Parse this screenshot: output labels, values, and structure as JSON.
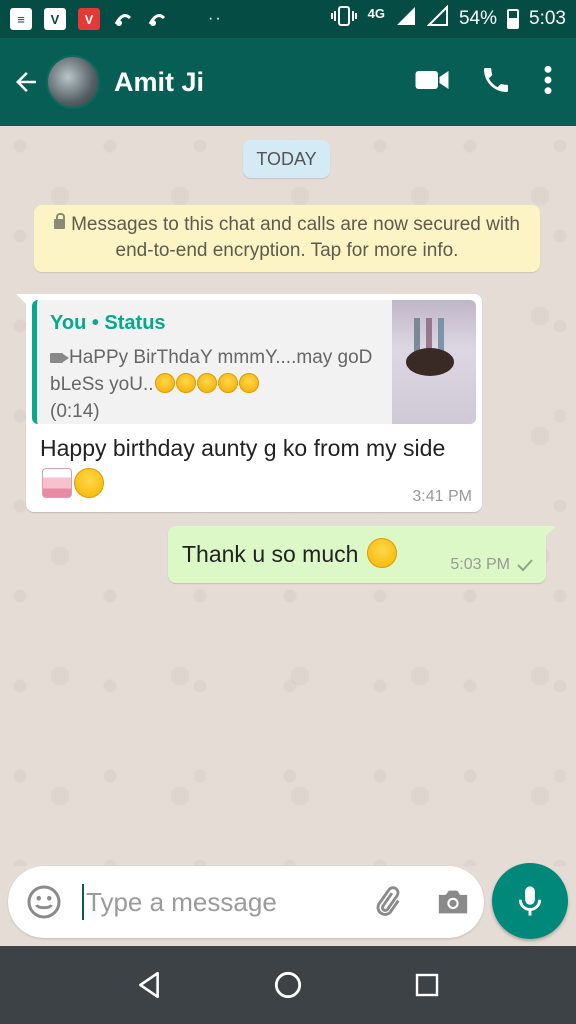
{
  "status_bar": {
    "network": "4G",
    "battery": "54%",
    "time": "5:03",
    "dots": "··"
  },
  "app_bar": {
    "contact_name": "Amit Ji"
  },
  "chat": {
    "date_label": "TODAY",
    "encryption_notice": "Messages to this chat and calls are now secured with end-to-end encryption. Tap for more info.",
    "incoming": {
      "quote_author": "You • Status",
      "quote_text": "HaPPy BirThdaY mmmY....may goD bLeSs yoU..",
      "quote_duration": "(0:14)",
      "text": "Happy birthday aunty g ko from my side",
      "time": "3:41 PM"
    },
    "outgoing": {
      "text": "Thank u so much",
      "time": "5:03 PM"
    }
  },
  "composer": {
    "placeholder": "Type a message"
  },
  "colors": {
    "header": "#075e54",
    "status_bar": "#054d44",
    "accent": "#06a98e",
    "outgoing_bubble": "#dcf8c6",
    "fab": "#00897b"
  },
  "icons": [
    "back-arrow-icon",
    "video-call-icon",
    "phone-icon",
    "more-vert-icon",
    "lock-icon",
    "video-small-icon",
    "emoji-icon",
    "attach-icon",
    "camera-icon",
    "mic-icon",
    "check-icon",
    "nav-back-icon",
    "nav-home-icon",
    "nav-recents-icon"
  ]
}
